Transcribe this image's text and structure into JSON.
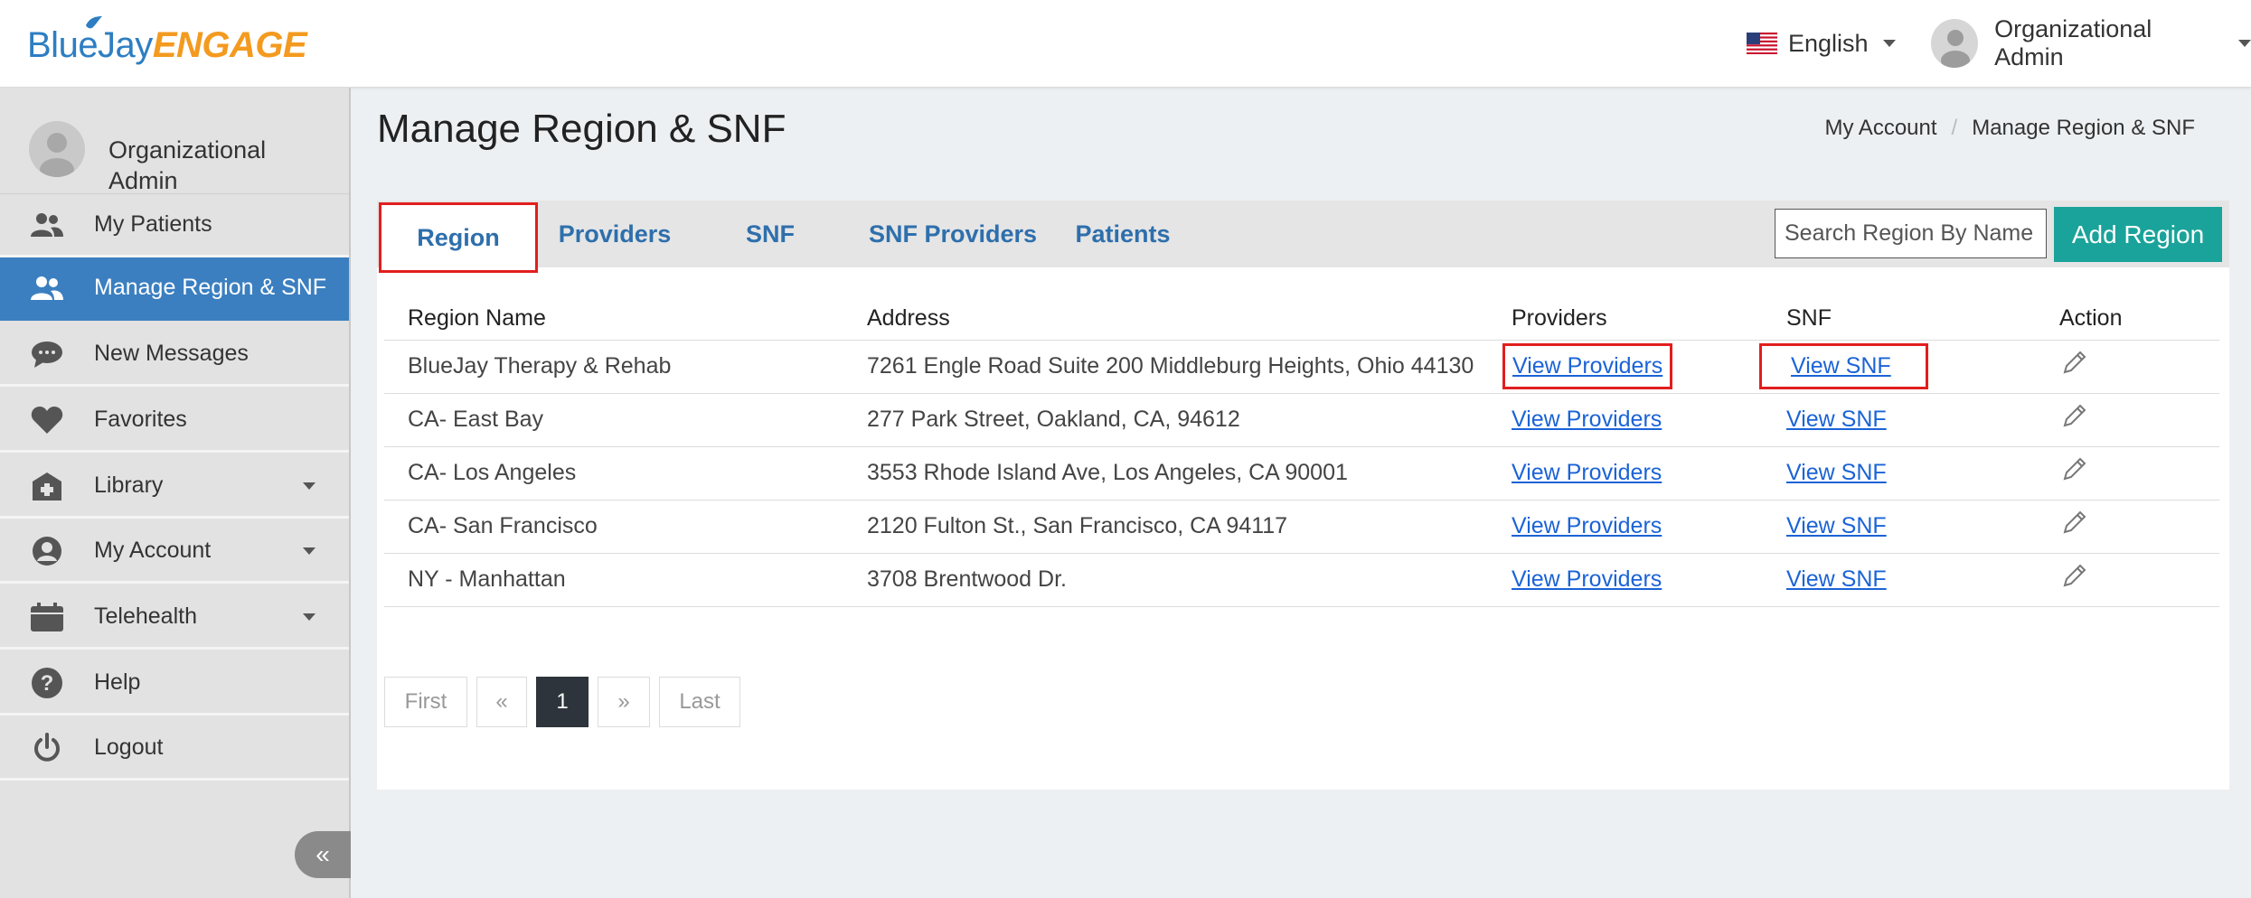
{
  "app": {
    "logo_part1": "BlueJay",
    "logo_part2": "ENGAGE"
  },
  "topbar": {
    "language": "English",
    "user_name": "Organizational Admin"
  },
  "sidebar": {
    "profile_name": "Organizational Admin",
    "items": [
      {
        "label": "My Patients",
        "icon": "users-icon"
      },
      {
        "label": "Manage Region & SNF",
        "icon": "users-icon",
        "active": true
      },
      {
        "label": "New Messages",
        "icon": "chat-icon"
      },
      {
        "label": "Favorites",
        "icon": "heart-icon"
      },
      {
        "label": "Library",
        "icon": "library-icon",
        "has_caret": true
      },
      {
        "label": "My Account",
        "icon": "account-icon",
        "has_caret": true
      },
      {
        "label": "Telehealth",
        "icon": "calendar-icon",
        "has_caret": true
      },
      {
        "label": "Help",
        "icon": "help-icon"
      },
      {
        "label": "Logout",
        "icon": "power-icon"
      }
    ],
    "collapse_label": "«"
  },
  "page": {
    "title": "Manage Region & SNF",
    "breadcrumb": [
      "My Account",
      "/",
      "Manage Region & SNF"
    ]
  },
  "tabs": [
    "Region",
    "Providers",
    "SNF",
    "SNF Providers",
    "Patients"
  ],
  "search": {
    "placeholder": "Search Region By Name",
    "value": ""
  },
  "add_button": "Add Region",
  "table": {
    "headers": [
      "Region Name",
      "Address",
      "Providers",
      "SNF",
      "Action"
    ],
    "rows": [
      {
        "name": "BlueJay Therapy & Rehab",
        "address": "7261 Engle Road Suite 200 Middleburg Heights, Ohio 44130",
        "providers": "View Providers",
        "snf": "View SNF"
      },
      {
        "name": "CA- East Bay",
        "address": "277 Park Street, Oakland, CA, 94612",
        "providers": "View Providers",
        "snf": "View SNF"
      },
      {
        "name": "CA- Los Angeles",
        "address": "3553 Rhode Island Ave, Los Angeles, CA 90001",
        "providers": "View Providers",
        "snf": "View SNF"
      },
      {
        "name": "CA- San Francisco",
        "address": "2120 Fulton St., San Francisco, CA 94117",
        "providers": "View Providers",
        "snf": "View SNF"
      },
      {
        "name": "NY - Manhattan",
        "address": "3708 Brentwood Dr.",
        "providers": "View Providers",
        "snf": "View SNF"
      }
    ]
  },
  "pagination": [
    "First",
    "«",
    "1",
    "»",
    "Last"
  ],
  "colors": {
    "primary_blue": "#3b7fc0",
    "tab_text": "#2e6fac",
    "add_button": "#1aa39a",
    "highlight_red": "#e21e1e",
    "link": "#1b63d6"
  }
}
